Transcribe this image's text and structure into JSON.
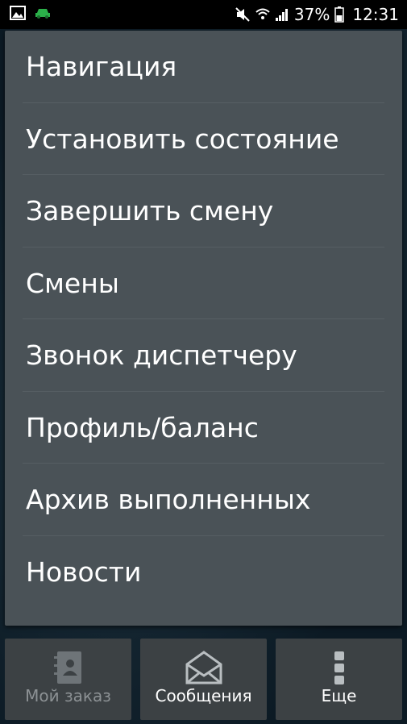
{
  "status_bar": {
    "battery_percent": "37%",
    "time": "12:31"
  },
  "menu": {
    "items": [
      {
        "label": "Навигация"
      },
      {
        "label": "Установить состояние"
      },
      {
        "label": "Завершить смену"
      },
      {
        "label": "Смены"
      },
      {
        "label": "Звонок диспетчеру"
      },
      {
        "label": "Профиль/баланс"
      },
      {
        "label": "Архив выполненных"
      },
      {
        "label": "Новости"
      }
    ]
  },
  "bottom_tabs": [
    {
      "label": "Мой заказ",
      "icon": "contact-book-icon",
      "enabled": false
    },
    {
      "label": "Сообщения",
      "icon": "envelope-icon",
      "enabled": true
    },
    {
      "label": "Еще",
      "icon": "more-vertical-icon",
      "enabled": true
    }
  ],
  "colors": {
    "menu_background": "#4a5257",
    "tab_background": "#3c4144",
    "status_bar": "#000000"
  }
}
